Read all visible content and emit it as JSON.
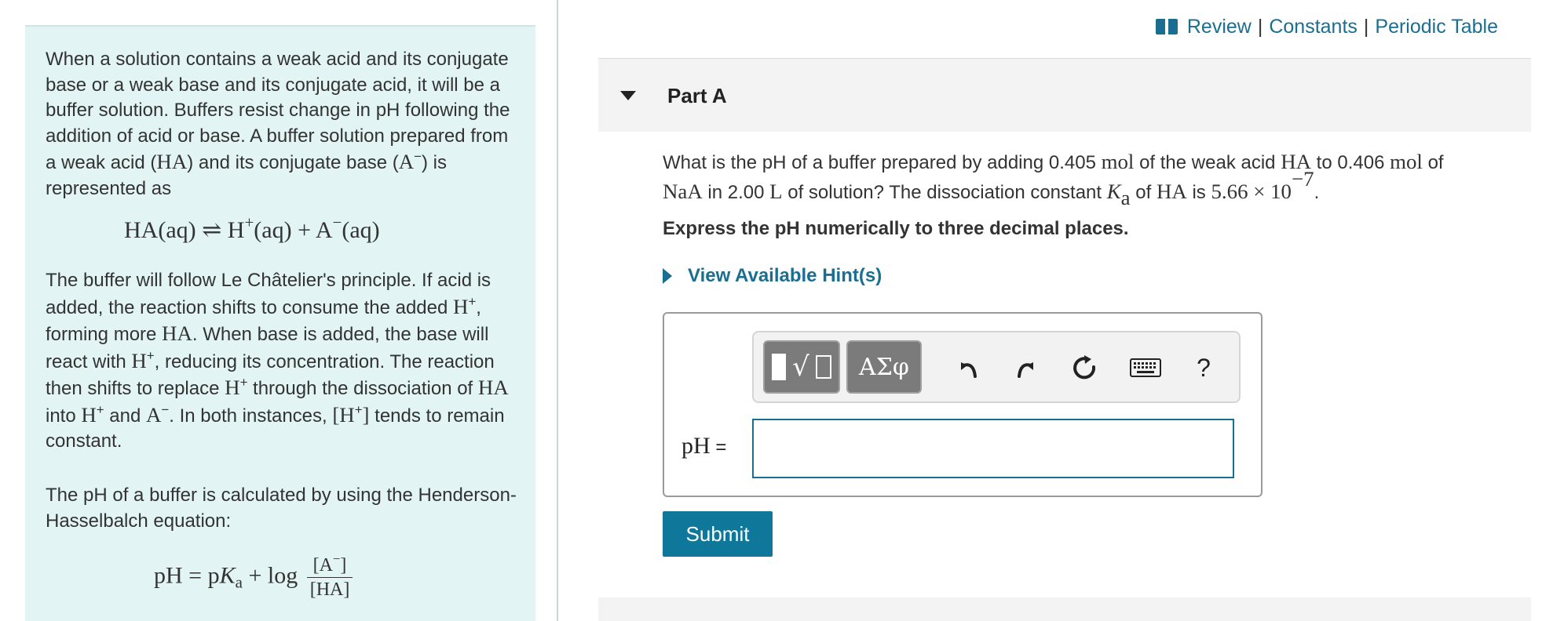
{
  "intro": {
    "p1_a": "When a solution contains a weak acid and its conjugate base or a weak base and its conjugate acid, it will be a buffer  solution. Buffers resist change in pH following the addition of acid or base. A buffer solution prepared from a weak acid (",
    "p1_ha": "HA",
    "p1_b": ") and its conjugate base (",
    "p1_a_minus": "A",
    "p1_c": ") is represented as",
    "equilibrium": {
      "ha": "HA(aq)",
      "arrow": "⇌",
      "h": "H",
      "aq1": "(aq) + A",
      "aq2": "(aq)"
    },
    "p2_a": "The buffer will follow Le Châtelier's principle. If acid is added, the reaction shifts to consume the added ",
    "p2_h1": "H",
    "p2_b": ", forming more ",
    "p2_ha1": "HA",
    "p2_c": ". When base is added, the base will react with ",
    "p2_h2": "H",
    "p2_d": ", reducing its concentration. The reaction then shifts to replace ",
    "p2_h3": "H",
    "p2_e": " through the dissociation of ",
    "p2_ha2": "HA",
    "p2_f": " into ",
    "p2_h4": "H",
    "p2_g": " and ",
    "p2_a_minus": "A",
    "p2_h": ". In both instances, ",
    "p2_bracket": "[H",
    "p2_i": " tends to remain constant.",
    "p3": "The pH of a buffer is calculated by using the Henderson-Hasselbalch equation:",
    "hh": {
      "lhs": "pH = p",
      "k": "K",
      "a": "a",
      "log": " + log",
      "num": "[A",
      "den": "[HA]"
    }
  },
  "toplinks": {
    "review": "Review",
    "constants": "Constants",
    "periodic": "Periodic Table",
    "sep": "|"
  },
  "part": {
    "title": "Part A"
  },
  "question": {
    "t1": "What is the pH of a buffer prepared by adding 0.405 ",
    "mol1": "mol",
    "t2": " of the weak acid ",
    "ha1": "HA",
    "t3": " to 0.406 ",
    "mol2": "mol",
    "t4": " of ",
    "naa": "NaA",
    "t5": " in 2.00 ",
    "liter": "L",
    "t6": " of solution? The dissociation constant ",
    "k": "K",
    "ksub": "a",
    "t7": " of ",
    "ha2": "HA",
    "t8": " is ",
    "val": "5.66 × 10",
    "exp": "−7",
    "t9": "."
  },
  "express": "Express the pH numerically to three decimal places.",
  "hint": "View Available Hint(s)",
  "toolbar": {
    "symbols_label": "ΑΣφ",
    "help_label": "?"
  },
  "answer": {
    "label": "pH",
    "equals": " =",
    "value": ""
  },
  "submit": "Submit",
  "colors": {
    "accent": "#1a6e90",
    "submit_bg": "#0f7799",
    "intro_bg": "#e3f4f4"
  },
  "icons": [
    "book-icon",
    "caret-down-icon",
    "templates-icon",
    "undo-icon",
    "redo-icon",
    "reset-icon",
    "keyboard-icon",
    "help-icon",
    "hint-triangle-icon"
  ]
}
